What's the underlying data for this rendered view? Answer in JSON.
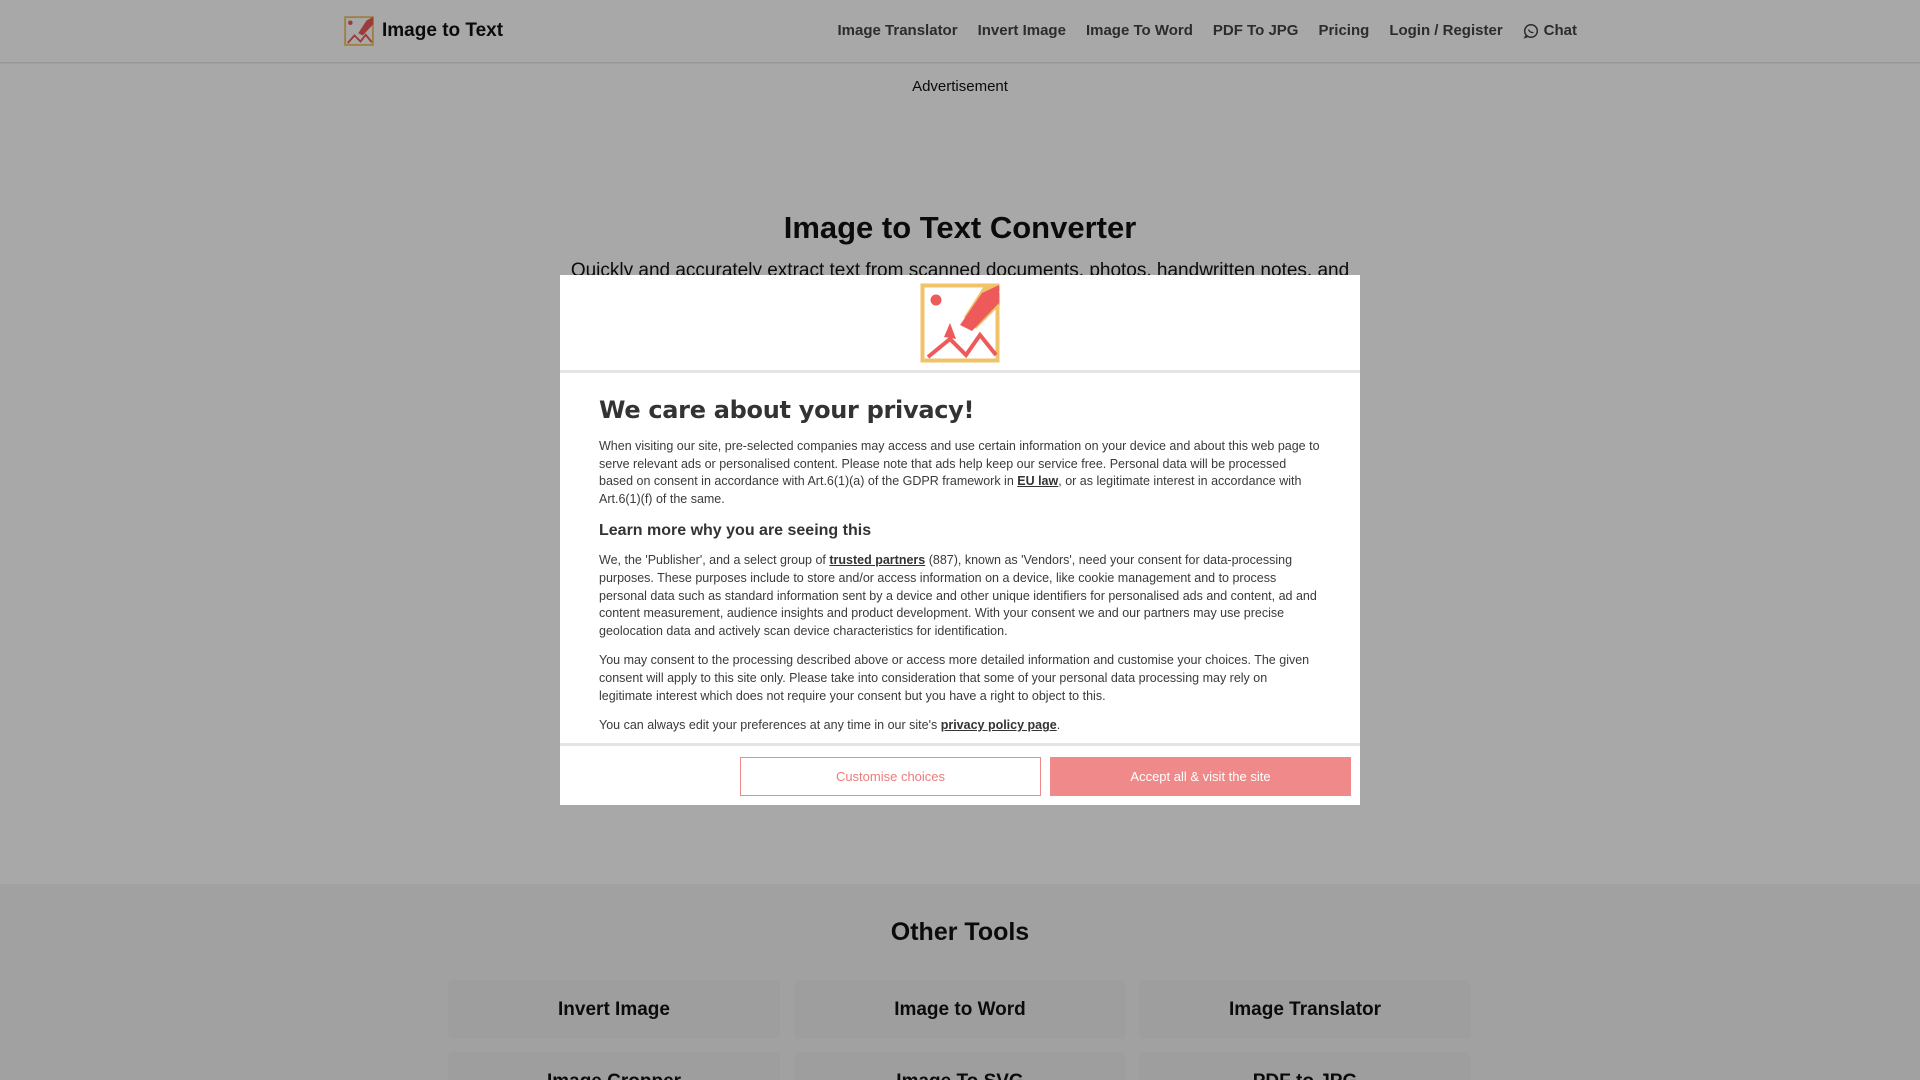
{
  "header": {
    "brand_name": "Image to Text",
    "nav": [
      "Image Translator",
      "Invert Image",
      "Image To Word",
      "PDF To JPG",
      "Pricing",
      "Login / Register"
    ],
    "chat_label": "Chat"
  },
  "main": {
    "ad_label": "Advertisement",
    "title": "Image to Text Converter",
    "subtitle": "Quickly and accurately extract text from scanned documents, photos, handwritten notes, and"
  },
  "other_tools": {
    "title": "Other Tools",
    "items": [
      "Invert Image",
      "Image to Word",
      "Image Translator",
      "Image Cropper",
      "Image To SVG",
      "PDF to JPG"
    ]
  },
  "consent": {
    "title": "We care about your privacy!",
    "p1_a": "When visiting our site, pre-selected companies may access and use certain information on your device and about this web page to serve relevant ads or personalised content. Please note that ads help keep our service free. Personal data will be processed based on consent in accordance with Art.6(1)(a) of the GDPR framework in ",
    "p1_link": "EU law",
    "p1_b": ", or as legitimate interest in accordance with Art.6(1)(f) of the same.",
    "subhead": "Learn more why you are seeing this",
    "p2_a": "We, the 'Publisher', and a select group of ",
    "p2_link": "trusted partners",
    "p2_b": " (887), known as 'Vendors', need your consent for data-processing purposes. These purposes include to store and/or access information on a device, like cookie management and to process personal data such as standard information sent by a device and other unique identifiers for personalised ads and content, ad and content measurement, audience insights and product development. With your consent we and our partners may use precise geolocation data and actively scan device characteristics for identification.",
    "p3": "You may consent to the processing described above or access more detailed information and customise your choices. The given consent will apply to this site only. Please take into consideration that some of your personal data processing may rely on legitimate interest which does not require your consent but you have a right to object to this.",
    "p4_a": "You can always edit your preferences at any time in our site's ",
    "p4_link": "privacy policy page",
    "p4_b": ".",
    "customise_label": "Customise choices",
    "accept_label": "Accept all & visit the site"
  },
  "colors": {
    "accent": "#f08a8a",
    "logo_yellow": "#f0c36a",
    "logo_red": "#ee5a5a"
  }
}
